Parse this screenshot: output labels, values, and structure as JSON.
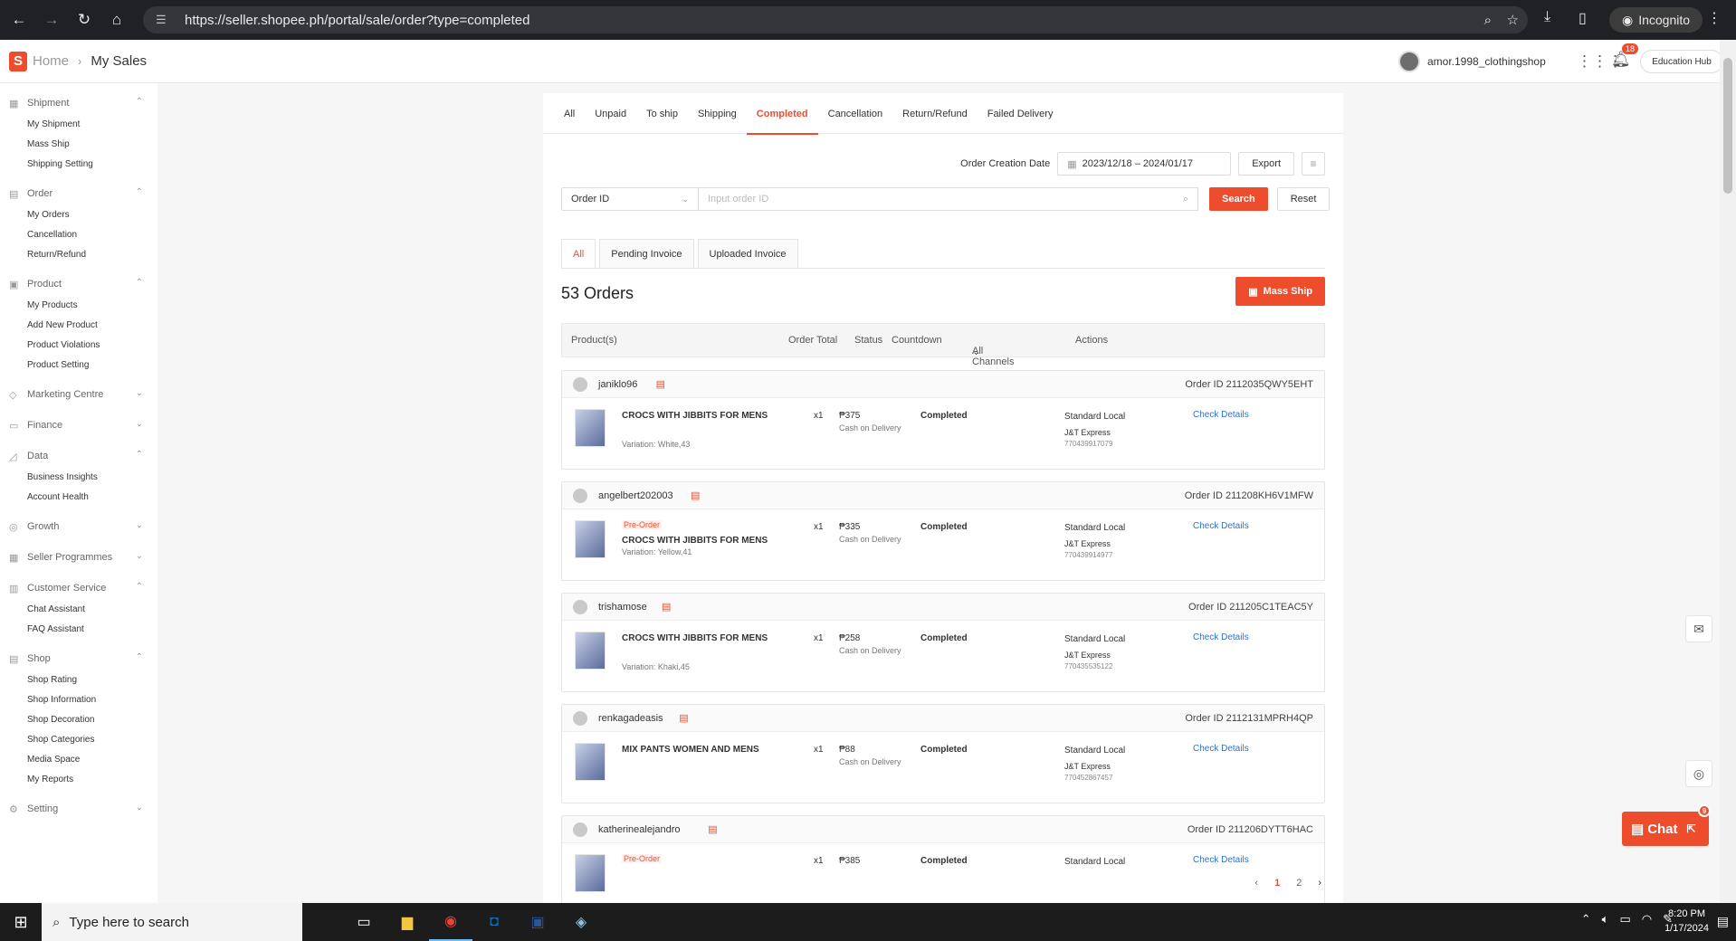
{
  "browser": {
    "url": "https://seller.shopee.ph/portal/sale/order?type=completed",
    "incognito": "Incognito"
  },
  "header": {
    "logo": "S",
    "home": "Home",
    "current": "My Sales",
    "username": "amor.1998_clothingshop",
    "notif_count": "18",
    "edu_hub": "Education Hub"
  },
  "sidebar": [
    {
      "title": "Shipment",
      "icon": "truck-icon",
      "items": [
        "My Shipment",
        "Mass Ship",
        "Shipping Setting"
      ]
    },
    {
      "title": "Order",
      "icon": "clipboard-icon",
      "items": [
        "My Orders",
        "Cancellation",
        "Return/Refund"
      ]
    },
    {
      "title": "Product",
      "icon": "box-icon",
      "items": [
        "My Products",
        "Add New Product",
        "Product Violations",
        "Product Setting"
      ]
    },
    {
      "title": "Marketing Centre",
      "icon": "tag-icon",
      "items": []
    },
    {
      "title": "Finance",
      "icon": "wallet-icon",
      "items": []
    },
    {
      "title": "Data",
      "icon": "chart-icon",
      "items": [
        "Business Insights",
        "Account Health"
      ]
    },
    {
      "title": "Growth",
      "icon": "growth-icon",
      "items": []
    },
    {
      "title": "Seller Programmes",
      "icon": "grid-icon",
      "items": []
    },
    {
      "title": "Customer Service",
      "icon": "headset-icon",
      "items": [
        "Chat Assistant",
        "FAQ Assistant"
      ]
    },
    {
      "title": "Shop",
      "icon": "shop-icon",
      "items": [
        "Shop Rating",
        "Shop Information",
        "Shop Decoration",
        "Shop Categories",
        "Media Space",
        "My Reports"
      ]
    },
    {
      "title": "Setting",
      "icon": "gear-icon",
      "items": []
    }
  ],
  "tabs": [
    "All",
    "Unpaid",
    "To ship",
    "Shipping",
    "Completed",
    "Cancellation",
    "Return/Refund",
    "Failed Delivery"
  ],
  "active_tab": "Completed",
  "filters": {
    "date_label": "Order Creation Date",
    "date_range": "2023/12/18 – 2024/01/17",
    "export": "Export",
    "field": "Order ID",
    "placeholder": "Input order ID",
    "search": "Search",
    "reset": "Reset"
  },
  "subtabs": [
    "All",
    "Pending Invoice",
    "Uploaded Invoice"
  ],
  "count": "53 Orders",
  "mass_ship": "Mass Ship",
  "columns": {
    "product": "Product(s)",
    "total": "Order Total",
    "status": "Status",
    "countdown": "Countdown",
    "channels": "All Channels",
    "actions": "Actions"
  },
  "orders": [
    {
      "buyer": "janiklo96",
      "order_id": "Order ID 2112035QWY5EHT",
      "pre": "",
      "product": "CROCS WITH JIBBITS FOR MENS",
      "variation": "Variation: White,43",
      "qty": "x1",
      "total": "₱375",
      "payment": "Cash on Delivery",
      "status": "Completed",
      "channel": "Standard Local",
      "carrier": "J&T Express",
      "tracking": "770439917079",
      "action": "Check Details"
    },
    {
      "buyer": "angelbert202003",
      "order_id": "Order ID 211208KH6V1MFW",
      "pre": "Pre-Order",
      "product": "CROCS WITH JIBBITS FOR MENS",
      "variation": "Variation: Yellow,41",
      "qty": "x1",
      "total": "₱335",
      "payment": "Cash on Delivery",
      "status": "Completed",
      "channel": "Standard Local",
      "carrier": "J&T Express",
      "tracking": "770439914977",
      "action": "Check Details"
    },
    {
      "buyer": "trishamose",
      "order_id": "Order ID 211205C1TEAC5Y",
      "pre": "",
      "product": "CROCS WITH JIBBITS FOR MENS",
      "variation": "Variation: Khaki,45",
      "qty": "x1",
      "total": "₱258",
      "payment": "Cash on Delivery",
      "status": "Completed",
      "channel": "Standard Local",
      "carrier": "J&T Express",
      "tracking": "770435535122",
      "action": "Check Details"
    },
    {
      "buyer": "renkagadeasis",
      "order_id": "Order ID 2112131MPRH4QP",
      "pre": "",
      "product": "MIX PANTS WOMEN AND MENS",
      "variation": "",
      "qty": "x1",
      "total": "₱88",
      "payment": "Cash on Delivery",
      "status": "Completed",
      "channel": "Standard Local",
      "carrier": "J&T Express",
      "tracking": "770452867457",
      "action": "Check Details"
    },
    {
      "buyer": "katherinealejandro",
      "order_id": "Order ID 211206DYTT6HAC",
      "pre": "Pre-Order",
      "product": "",
      "variation": "",
      "qty": "x1",
      "total": "₱385",
      "payment": "",
      "status": "Completed",
      "channel": "Standard Local",
      "carrier": "",
      "tracking": "",
      "action": "Check Details"
    }
  ],
  "pager": [
    "1",
    "2"
  ],
  "chat": {
    "label": "Chat",
    "badge": "9"
  },
  "taskbar": {
    "search": "Type here to search",
    "time": "8:20 PM",
    "date": "1/17/2024"
  }
}
